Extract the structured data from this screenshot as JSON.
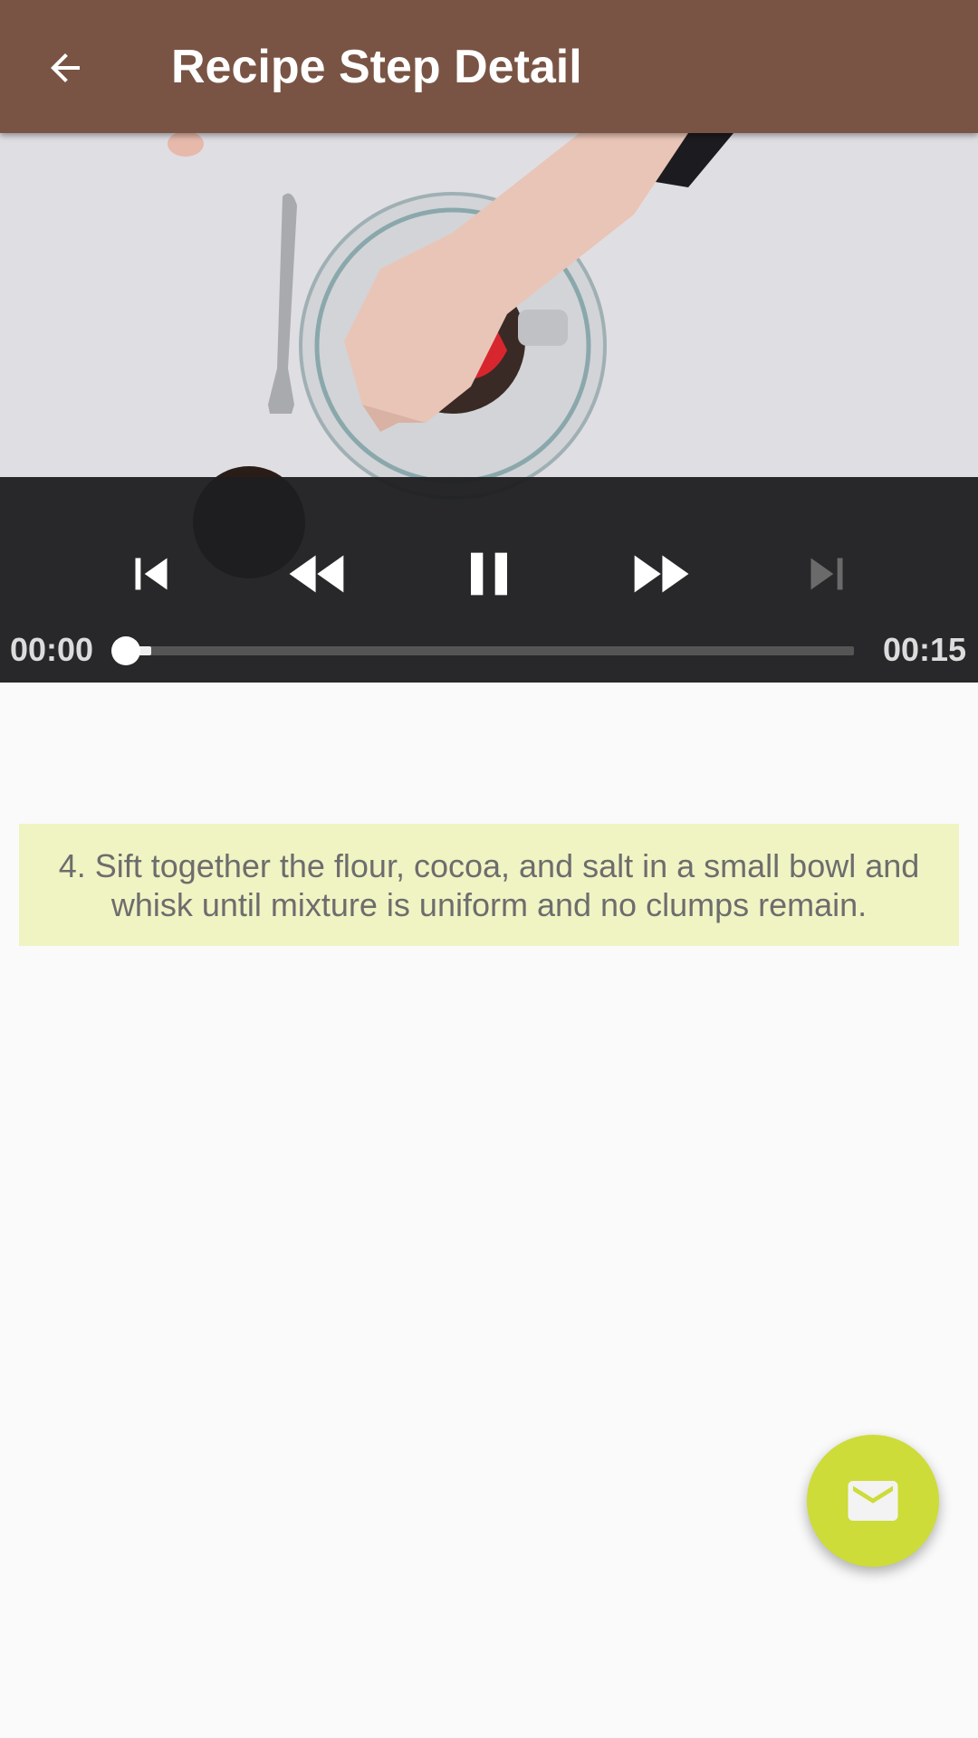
{
  "app_bar": {
    "title": "Recipe Step Detail",
    "back_icon": "arrow-back-icon",
    "background_color": "#795444"
  },
  "player": {
    "current_time": "00:00",
    "duration": "00:15",
    "progress_fraction": 0.005,
    "buffered_fraction": 0.04,
    "state": "playing",
    "controls": [
      {
        "name": "skip-previous-icon",
        "enabled": true
      },
      {
        "name": "rewind-icon",
        "enabled": true
      },
      {
        "name": "pause-icon",
        "enabled": true
      },
      {
        "name": "fast-forward-icon",
        "enabled": true
      },
      {
        "name": "skip-next-icon",
        "enabled": false
      }
    ]
  },
  "step": {
    "description": "4. Sift together the flour, cocoa, and salt in a small bowl and whisk until mixture is uniform and no clumps remain.",
    "background_color": "#f0f4c3"
  },
  "fab": {
    "icon": "email-icon",
    "color": "#cddc39"
  }
}
